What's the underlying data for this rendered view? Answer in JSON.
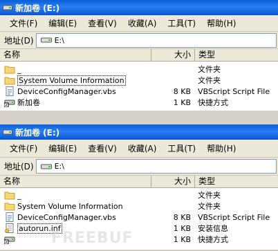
{
  "windows": [
    {
      "title": "新加卷 (E:)",
      "menu": [
        "文件(F)",
        "编辑(E)",
        "查看(V)",
        "收藏(A)",
        "工具(T)",
        "帮助(H)"
      ],
      "address_label": "地址(D)",
      "address_value": "E:\\",
      "columns": {
        "name": "名称",
        "size": "大小",
        "type": "类型"
      },
      "rows": [
        {
          "name": "_",
          "size": "",
          "type": "文件夹",
          "icon": "folder-icon"
        },
        {
          "name": "System Volume Information",
          "size": "",
          "type": "文件夹",
          "icon": "folder-icon"
        },
        {
          "name": "DeviceConfigManager.vbs",
          "size": "8 KB",
          "type": "VBScript Script File",
          "icon": "vbs-file-icon"
        },
        {
          "name": "新加卷",
          "size": "1 KB",
          "type": "快捷方式",
          "icon": "drive-shortcut-icon"
        }
      ]
    },
    {
      "title": "新加卷 (E:)",
      "menu": [
        "文件(F)",
        "编辑(E)",
        "查看(V)",
        "收藏(A)",
        "工具(T)",
        "帮助(H)"
      ],
      "address_label": "地址(D)",
      "address_value": "E:\\",
      "columns": {
        "name": "名称",
        "size": "大小",
        "type": "类型"
      },
      "rows": [
        {
          "name": "_",
          "size": "",
          "type": "文件夹",
          "icon": "folder-icon"
        },
        {
          "name": "System Volume Information",
          "size": "",
          "type": "文件夹",
          "icon": "folder-icon"
        },
        {
          "name": "DeviceConfigManager.vbs",
          "size": "8 KB",
          "type": "VBScript Script File",
          "icon": "vbs-file-icon"
        },
        {
          "name": "autorun.inf",
          "size": "1 KB",
          "type": "安装信息",
          "icon": "inf-file-icon"
        },
        {
          "name": "",
          "size": "1 KB",
          "type": "快捷方式",
          "icon": "drive-shortcut-icon"
        }
      ]
    }
  ],
  "watermark": "FREEBUF"
}
